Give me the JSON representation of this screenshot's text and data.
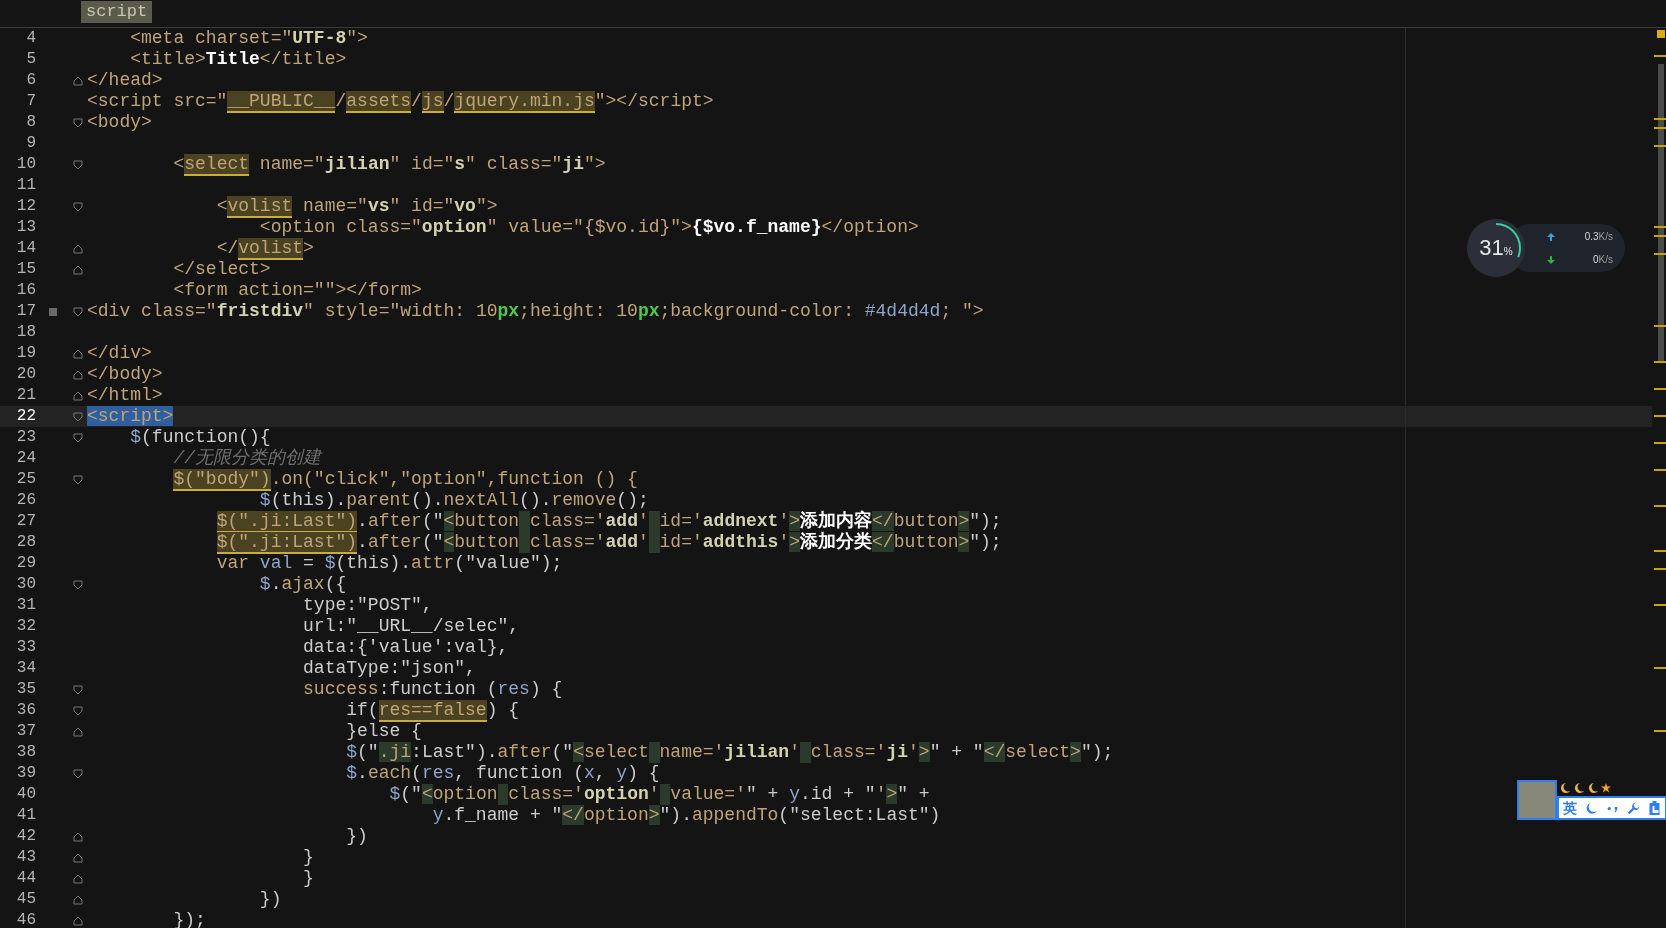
{
  "tab": {
    "label": "script"
  },
  "lines": [
    {
      "n": "4",
      "bookmark": false,
      "current": false,
      "tokens": [
        {
          "kind": "tag",
          "text": "    <meta charset=\""
        },
        {
          "kind": "str",
          "text": "UTF-8"
        },
        {
          "kind": "tag",
          "text": "\">"
        }
      ]
    },
    {
      "n": "5",
      "bookmark": false,
      "current": false,
      "tokens": [
        {
          "kind": "tag",
          "text": "    <title>"
        },
        {
          "kind": "txt",
          "text": "Title"
        },
        {
          "kind": "tag",
          "text": "</title>"
        }
      ]
    },
    {
      "n": "6",
      "fold_end": true,
      "bookmark": false,
      "current": false,
      "tokens": [
        {
          "kind": "tag",
          "text": "</head>"
        }
      ]
    },
    {
      "n": "7",
      "bookmark": false,
      "current": false,
      "tokens": [
        {
          "kind": "tag",
          "text": "<script src=\""
        },
        {
          "kind": "hl",
          "text": "__PUBLIC__"
        },
        {
          "kind": "tag",
          "text": "/"
        },
        {
          "kind": "hl",
          "text": "assets"
        },
        {
          "kind": "tag",
          "text": "/"
        },
        {
          "kind": "hl",
          "text": "js"
        },
        {
          "kind": "tag",
          "text": "/"
        },
        {
          "kind": "hl",
          "text": "jquery.min.js"
        },
        {
          "kind": "tag",
          "text": "\"></script>"
        }
      ]
    },
    {
      "n": "8",
      "fold_start": true,
      "bookmark": false,
      "current": false,
      "tokens": [
        {
          "kind": "tag",
          "text": "<body>"
        }
      ]
    },
    {
      "n": "9",
      "bookmark": false,
      "current": false
    },
    {
      "n": "10",
      "fold_start": true,
      "bookmark": false,
      "current": false,
      "tokens": [
        {
          "kind": "tag",
          "text": "        <"
        },
        {
          "kind": "hl",
          "text": "select"
        },
        {
          "kind": "tag",
          "text": " name=\""
        },
        {
          "kind": "str",
          "text": "jilian"
        },
        {
          "kind": "tag",
          "text": "\" id=\""
        },
        {
          "kind": "str",
          "text": "s"
        },
        {
          "kind": "tag",
          "text": "\" class=\""
        },
        {
          "kind": "str",
          "text": "ji"
        },
        {
          "kind": "tag",
          "text": "\">"
        }
      ]
    },
    {
      "n": "11",
      "bookmark": false,
      "current": false
    },
    {
      "n": "12",
      "fold_start": true,
      "bookmark": false,
      "current": false,
      "tokens": [
        {
          "kind": "tag",
          "text": "            <"
        },
        {
          "kind": "hl",
          "text": "volist"
        },
        {
          "kind": "tag",
          "text": " name=\""
        },
        {
          "kind": "str",
          "text": "vs"
        },
        {
          "kind": "tag",
          "text": "\" id=\""
        },
        {
          "kind": "str",
          "text": "vo"
        },
        {
          "kind": "tag",
          "text": "\">"
        }
      ]
    },
    {
      "n": "13",
      "bookmark": false,
      "current": false,
      "tokens": [
        {
          "kind": "tag",
          "text": "                <option class=\""
        },
        {
          "kind": "str",
          "text": "option"
        },
        {
          "kind": "tag",
          "text": "\" value=\"{$vo.id}\">"
        },
        {
          "kind": "txt",
          "text": "{$vo.f_name}"
        },
        {
          "kind": "tag",
          "text": "</option>"
        }
      ]
    },
    {
      "n": "14",
      "fold_end": true,
      "bookmark": false,
      "current": false,
      "tokens": [
        {
          "kind": "tag",
          "text": "            </"
        },
        {
          "kind": "hl",
          "text": "volist"
        },
        {
          "kind": "tag",
          "text": ">"
        }
      ]
    },
    {
      "n": "15",
      "fold_end": true,
      "bookmark": false,
      "current": false,
      "tokens": [
        {
          "kind": "tag",
          "text": "        </select>"
        }
      ]
    },
    {
      "n": "16",
      "bookmark": false,
      "current": false,
      "tokens": [
        {
          "kind": "tag",
          "text": "        <form action=\"\"></form>"
        }
      ]
    },
    {
      "n": "17",
      "fold_start": true,
      "bookmark": true,
      "current": false,
      "tokens": [
        {
          "kind": "tag",
          "text": "<div class=\""
        },
        {
          "kind": "str",
          "text": "fristdiv"
        },
        {
          "kind": "tag",
          "text": "\" style=\"width: 10"
        },
        {
          "kind": "px",
          "text": "px"
        },
        {
          "kind": "tag",
          "text": ";height: 10"
        },
        {
          "kind": "px",
          "text": "px"
        },
        {
          "kind": "tag",
          "text": ";background-color: "
        },
        {
          "kind": "var",
          "text": "#4d4d4d"
        },
        {
          "kind": "tag",
          "text": "; \">"
        }
      ]
    },
    {
      "n": "18",
      "bookmark": false,
      "current": false
    },
    {
      "n": "19",
      "fold_end": true,
      "bookmark": false,
      "current": false,
      "tokens": [
        {
          "kind": "tag",
          "text": "</div>"
        }
      ]
    },
    {
      "n": "20",
      "fold_end": true,
      "bookmark": false,
      "current": false,
      "tokens": [
        {
          "kind": "tag",
          "text": "</body>"
        }
      ]
    },
    {
      "n": "21",
      "fold_end": true,
      "bookmark": false,
      "current": false,
      "tokens": [
        {
          "kind": "tag",
          "text": "</html>"
        }
      ]
    },
    {
      "n": "22",
      "fold_start": true,
      "bookmark": false,
      "current": true,
      "tokens": [
        {
          "kind": "sel",
          "text": "<script>"
        }
      ]
    },
    {
      "n": "23",
      "fold_start": true,
      "bookmark": false,
      "current": false,
      "tokens": [
        {
          "kind": "var",
          "text": "    $"
        },
        {
          "kind": "plain",
          "text": "(function(){"
        }
      ]
    },
    {
      "n": "24",
      "bookmark": false,
      "current": false,
      "tokens": [
        {
          "kind": "cmt",
          "text": "        //无限分类的创建"
        }
      ]
    },
    {
      "n": "25",
      "fold_start": true,
      "bookmark": false,
      "current": false,
      "tokens": [
        {
          "kind": "hl",
          "text": "        $(\"body\")"
        },
        {
          "kind": "fn",
          "text": ".on(\"click\",\"option\",function () {"
        }
      ]
    },
    {
      "n": "26",
      "bookmark": false,
      "current": false,
      "tokens": [
        {
          "kind": "var",
          "text": "                $"
        },
        {
          "kind": "plain",
          "text": "(this)."
        },
        {
          "kind": "fn",
          "text": "parent"
        },
        {
          "kind": "plain",
          "text": "()."
        },
        {
          "kind": "fn",
          "text": "nextAll"
        },
        {
          "kind": "plain",
          "text": "()."
        },
        {
          "kind": "fn",
          "text": "remove"
        },
        {
          "kind": "plain",
          "text": "();"
        }
      ]
    },
    {
      "n": "27",
      "bookmark": false,
      "current": false,
      "tokens": [
        {
          "kind": "hl",
          "text": "            $(\".ji:Last\")"
        },
        {
          "kind": "plain",
          "text": "."
        },
        {
          "kind": "fn",
          "text": "after"
        },
        {
          "kind": "plain",
          "text": "(\""
        },
        {
          "kind": "g",
          "text": "<"
        },
        {
          "kind": "tag",
          "text": "button"
        },
        {
          "kind": "gs"
        },
        {
          "kind": "tag",
          "text": "class='"
        },
        {
          "kind": "str",
          "text": "add"
        },
        {
          "kind": "tag",
          "text": "'"
        },
        {
          "kind": "gs"
        },
        {
          "kind": "tag",
          "text": "id='"
        },
        {
          "kind": "str",
          "text": "addnext"
        },
        {
          "kind": "tag",
          "text": "'"
        },
        {
          "kind": "g",
          "text": ">"
        },
        {
          "kind": "txt",
          "text": "添加内容"
        },
        {
          "kind": "g",
          "text": "</"
        },
        {
          "kind": "tag",
          "text": "button"
        },
        {
          "kind": "g",
          "text": ">"
        },
        {
          "kind": "plain",
          "text": "\");"
        }
      ]
    },
    {
      "n": "28",
      "bookmark": false,
      "current": false,
      "tokens": [
        {
          "kind": "hl",
          "text": "            $(\".ji:Last\")"
        },
        {
          "kind": "plain",
          "text": "."
        },
        {
          "kind": "fn",
          "text": "after"
        },
        {
          "kind": "plain",
          "text": "(\""
        },
        {
          "kind": "g",
          "text": "<"
        },
        {
          "kind": "tag",
          "text": "button"
        },
        {
          "kind": "gs"
        },
        {
          "kind": "tag",
          "text": "class='"
        },
        {
          "kind": "str",
          "text": "add"
        },
        {
          "kind": "tag",
          "text": "'"
        },
        {
          "kind": "gs"
        },
        {
          "kind": "tag",
          "text": "id='"
        },
        {
          "kind": "str",
          "text": "addthis"
        },
        {
          "kind": "tag",
          "text": "'"
        },
        {
          "kind": "g",
          "text": ">"
        },
        {
          "kind": "txt",
          "text": "添加分类"
        },
        {
          "kind": "g",
          "text": "</"
        },
        {
          "kind": "tag",
          "text": "button"
        },
        {
          "kind": "g",
          "text": ">"
        },
        {
          "kind": "plain",
          "text": "\");"
        }
      ]
    },
    {
      "n": "29",
      "bookmark": false,
      "current": false,
      "tokens": [
        {
          "kind": "fn",
          "text": "            var "
        },
        {
          "kind": "var",
          "text": "val"
        },
        {
          "kind": "plain",
          "text": " = "
        },
        {
          "kind": "var",
          "text": "$"
        },
        {
          "kind": "plain",
          "text": "(this)."
        },
        {
          "kind": "fn",
          "text": "attr"
        },
        {
          "kind": "plain",
          "text": "(\"value\");"
        }
      ]
    },
    {
      "n": "30",
      "fold_start": true,
      "bookmark": false,
      "current": false,
      "tokens": [
        {
          "kind": "var",
          "text": "                $"
        },
        {
          "kind": "plain",
          "text": "."
        },
        {
          "kind": "fn",
          "text": "ajax"
        },
        {
          "kind": "plain",
          "text": "({"
        }
      ]
    },
    {
      "n": "31",
      "bookmark": false,
      "current": false,
      "tokens": [
        {
          "kind": "plain",
          "text": "                    type:\"POST\","
        }
      ]
    },
    {
      "n": "32",
      "bookmark": false,
      "current": false,
      "tokens": [
        {
          "kind": "plain",
          "text": "                    url:\"__URL__/selec\","
        }
      ]
    },
    {
      "n": "33",
      "bookmark": false,
      "current": false,
      "tokens": [
        {
          "kind": "plain",
          "text": "                    data:{'value':val},"
        }
      ]
    },
    {
      "n": "34",
      "bookmark": false,
      "current": false,
      "tokens": [
        {
          "kind": "plain",
          "text": "                    dataType:\"json\","
        }
      ]
    },
    {
      "n": "35",
      "fold_start": true,
      "bookmark": false,
      "current": false,
      "tokens": [
        {
          "kind": "fn",
          "text": "                    success"
        },
        {
          "kind": "plain",
          "text": ":function ("
        },
        {
          "kind": "var",
          "text": "res"
        },
        {
          "kind": "plain",
          "text": ") {"
        }
      ]
    },
    {
      "n": "36",
      "fold_start": true,
      "bookmark": false,
      "current": false,
      "tokens": [
        {
          "kind": "plain",
          "text": "                        if("
        },
        {
          "kind": "hl",
          "text": "res==false"
        },
        {
          "kind": "plain",
          "text": ") {"
        }
      ]
    },
    {
      "n": "37",
      "fold_end": true,
      "bookmark": false,
      "current": false,
      "tokens": [
        {
          "kind": "plain",
          "text": "                        }else {"
        }
      ]
    },
    {
      "n": "38",
      "bookmark": false,
      "current": false,
      "tokens": [
        {
          "kind": "var",
          "text": "                        $"
        },
        {
          "kind": "plain",
          "text": "(\""
        },
        {
          "kind": "g",
          "text": ".ji"
        },
        {
          "kind": "plain",
          "text": ":Last\")."
        },
        {
          "kind": "fn",
          "text": "after"
        },
        {
          "kind": "plain",
          "text": "(\""
        },
        {
          "kind": "g",
          "text": "<"
        },
        {
          "kind": "tag",
          "text": "select"
        },
        {
          "kind": "gs"
        },
        {
          "kind": "tag",
          "text": "name='"
        },
        {
          "kind": "str",
          "text": "jilian"
        },
        {
          "kind": "tag",
          "text": "'"
        },
        {
          "kind": "gs"
        },
        {
          "kind": "tag",
          "text": "class='"
        },
        {
          "kind": "str",
          "text": "ji"
        },
        {
          "kind": "tag",
          "text": "'"
        },
        {
          "kind": "g",
          "text": ">"
        },
        {
          "kind": "plain",
          "text": "\" + \""
        },
        {
          "kind": "g",
          "text": "</"
        },
        {
          "kind": "tag",
          "text": "select"
        },
        {
          "kind": "g",
          "text": ">"
        },
        {
          "kind": "plain",
          "text": "\");"
        }
      ]
    },
    {
      "n": "39",
      "fold_start": true,
      "bookmark": false,
      "current": false,
      "tokens": [
        {
          "kind": "var",
          "text": "                        $"
        },
        {
          "kind": "plain",
          "text": "."
        },
        {
          "kind": "fn",
          "text": "each"
        },
        {
          "kind": "plain",
          "text": "("
        },
        {
          "kind": "var",
          "text": "res"
        },
        {
          "kind": "plain",
          "text": ", function ("
        },
        {
          "kind": "var",
          "text": "x"
        },
        {
          "kind": "plain",
          "text": ", "
        },
        {
          "kind": "var",
          "text": "y"
        },
        {
          "kind": "plain",
          "text": ") {"
        }
      ]
    },
    {
      "n": "40",
      "bookmark": false,
      "current": false,
      "tokens": [
        {
          "kind": "var",
          "text": "                            $"
        },
        {
          "kind": "plain",
          "text": "(\""
        },
        {
          "kind": "g",
          "text": "<"
        },
        {
          "kind": "tag",
          "text": "option"
        },
        {
          "kind": "gs"
        },
        {
          "kind": "tag",
          "text": "class='"
        },
        {
          "kind": "str",
          "text": "option"
        },
        {
          "kind": "tag",
          "text": "'"
        },
        {
          "kind": "gs"
        },
        {
          "kind": "tag",
          "text": "value='"
        },
        {
          "kind": "plain",
          "text": "\" + "
        },
        {
          "kind": "var",
          "text": "y"
        },
        {
          "kind": "plain",
          "text": ".id + \""
        },
        {
          "kind": "tag",
          "text": "'"
        },
        {
          "kind": "g",
          "text": ">"
        },
        {
          "kind": "plain",
          "text": "\" +"
        }
      ]
    },
    {
      "n": "41",
      "bookmark": false,
      "current": false,
      "tokens": [
        {
          "kind": "var",
          "text": "                                y"
        },
        {
          "kind": "plain",
          "text": ".f_name + \""
        },
        {
          "kind": "g",
          "text": "</"
        },
        {
          "kind": "tag",
          "text": "option"
        },
        {
          "kind": "g",
          "text": ">"
        },
        {
          "kind": "plain",
          "text": "\")."
        },
        {
          "kind": "fn",
          "text": "appendTo"
        },
        {
          "kind": "plain",
          "text": "(\"select:Last\")"
        }
      ]
    },
    {
      "n": "42",
      "fold_end": true,
      "bookmark": false,
      "current": false,
      "tokens": [
        {
          "kind": "plain",
          "text": "                        })"
        }
      ]
    },
    {
      "n": "43",
      "fold_end": true,
      "bookmark": false,
      "current": false,
      "tokens": [
        {
          "kind": "plain",
          "text": "                    }"
        }
      ]
    },
    {
      "n": "44",
      "fold_end": true,
      "bookmark": false,
      "current": false,
      "tokens": [
        {
          "kind": "plain",
          "text": "                    }"
        }
      ]
    },
    {
      "n": "45",
      "fold_end": true,
      "bookmark": false,
      "current": false,
      "tokens": [
        {
          "kind": "plain",
          "text": "                })"
        }
      ]
    },
    {
      "n": "46",
      "fold_end": true,
      "bookmark": false,
      "current": false,
      "tokens": [
        {
          "kind": "plain",
          "text": "        });"
        }
      ]
    }
  ],
  "monitor": {
    "percent": "31",
    "unit": "%",
    "level": 0.31,
    "upload": "0.3",
    "upload_unit": "K/s",
    "download": "0",
    "download_unit": "K/s"
  },
  "ime_toolbar": {
    "language": "英"
  }
}
